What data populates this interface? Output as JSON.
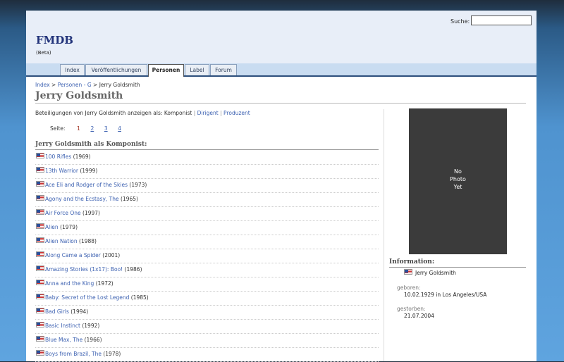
{
  "header": {
    "search_label": "Suche:",
    "search_value": "",
    "site_title": "FMDB",
    "site_subtitle": "(Beta)"
  },
  "nav": {
    "tabs": [
      {
        "label": "Index",
        "active": false
      },
      {
        "label": "Veröffentlichungen",
        "active": false
      },
      {
        "label": "Personen",
        "active": true
      },
      {
        "label": "Label",
        "active": false
      },
      {
        "label": "Forum",
        "active": false
      }
    ]
  },
  "breadcrumb": {
    "index": "Index",
    "sep1": ">",
    "personen": "Personen",
    "dash": "-",
    "letter": "G",
    "sep2": ">",
    "current": "Jerry Goldsmith"
  },
  "person": {
    "name": "Jerry Goldsmith",
    "roles_prefix": "Beteiligungen von Jerry Goldsmith anzeigen als:",
    "roles": [
      "Komponist",
      "Dirigent",
      "Produzent"
    ],
    "role_separator": "|"
  },
  "pager": {
    "label": "Seite:",
    "pages": [
      "1",
      "2",
      "3",
      "4"
    ],
    "current": "1"
  },
  "section": {
    "heading": "Jerry Goldsmith als Komponist:"
  },
  "films": [
    {
      "title": "100 Rifles",
      "year": "(1969)"
    },
    {
      "title": "13th Warrior",
      "year": "(1999)"
    },
    {
      "title": "Ace Eli and Rodger of the Skies",
      "year": "(1973)"
    },
    {
      "title": "Agony and the Ecstasy, The",
      "year": "(1965)"
    },
    {
      "title": "Air Force One",
      "year": "(1997)"
    },
    {
      "title": "Alien",
      "year": "(1979)"
    },
    {
      "title": "Alien Nation",
      "year": "(1988)"
    },
    {
      "title": "Along Came a Spider",
      "year": "(2001)"
    },
    {
      "title": "Amazing Stories (1x17): Boo!",
      "year": "(1986)"
    },
    {
      "title": "Anna and the King",
      "year": "(1972)"
    },
    {
      "title": "Baby: Secret of the Lost Legend",
      "year": "(1985)"
    },
    {
      "title": "Bad Girls",
      "year": "(1994)"
    },
    {
      "title": "Basic Instinct",
      "year": "(1992)"
    },
    {
      "title": "Blue Max, The",
      "year": "(1966)"
    },
    {
      "title": "Boys from Brazil, The",
      "year": "(1978)"
    }
  ],
  "photo": {
    "placeholder_lines": [
      "No",
      "Photo",
      "Yet"
    ]
  },
  "info": {
    "heading": "Information:",
    "name": "Jerry Goldsmith",
    "born_label": "geboren:",
    "born_value": "10.02.1929 in Los Angeles/USA",
    "died_label": "gestorben:",
    "died_value": "21.07.2004"
  },
  "colors": {
    "link": "#3a5fb0",
    "current_page": "#a03020",
    "nav_border": "#2d4f7c",
    "header_bg": "#e8eef8"
  },
  "icons": {
    "flag": "us-flag-icon"
  }
}
